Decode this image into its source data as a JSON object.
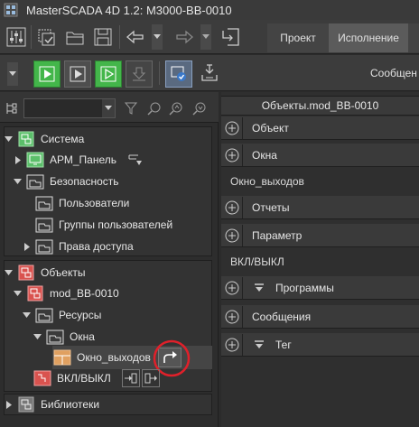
{
  "window": {
    "title": "MasterSCADA 4D 1.2: M3000-BB-0010"
  },
  "toolbar": {
    "tabs": [
      {
        "label": "Проект",
        "active": false
      },
      {
        "label": "Исполнение",
        "active": true
      }
    ]
  },
  "run_toolbar": {
    "messages_label": "Сообщен"
  },
  "tree": {
    "sections": [
      {
        "title": "Система",
        "items": [
          {
            "label": "АРМ_Панель"
          },
          {
            "label": "Безопасность"
          },
          {
            "label": "Пользователи"
          },
          {
            "label": "Группы пользователей"
          },
          {
            "label": "Права доступа"
          }
        ]
      },
      {
        "title": "Объекты",
        "items": [
          {
            "label": "mod_BB-0010"
          },
          {
            "label": "Ресурсы"
          },
          {
            "label": "Окна"
          },
          {
            "label": "Окно_выходов"
          },
          {
            "label": "ВКЛ/ВЫКЛ"
          }
        ]
      },
      {
        "title": "Библиотеки"
      }
    ]
  },
  "properties": {
    "header": "Объекты.mod_BB-0010",
    "rows": [
      {
        "label": "Объект"
      },
      {
        "label": "Окна"
      },
      {
        "value": "Окно_выходов"
      },
      {
        "label": "Отчеты"
      },
      {
        "label": "Параметр"
      },
      {
        "value": "ВКЛ/ВЫКЛ"
      },
      {
        "label": "Программы"
      },
      {
        "label": "Сообщения"
      },
      {
        "label": "Тег"
      }
    ]
  },
  "colors": {
    "accent_green": "#43b64a",
    "tree_green_icon": "#5bbf6a",
    "tree_red_icon": "#d9534f",
    "highlight_circle": "#e0202a"
  },
  "icons": {
    "app": "app-icon",
    "toolbar": [
      "settings-sliders-icon",
      "copy-object-icon",
      "open-folder-icon",
      "save-icon",
      "undo-icon",
      "redo-icon",
      "import-icon"
    ],
    "run": [
      "play-icon",
      "step-icon",
      "play-outline-icon",
      "download-icon",
      "monitor-check-icon",
      "export-icon"
    ]
  }
}
